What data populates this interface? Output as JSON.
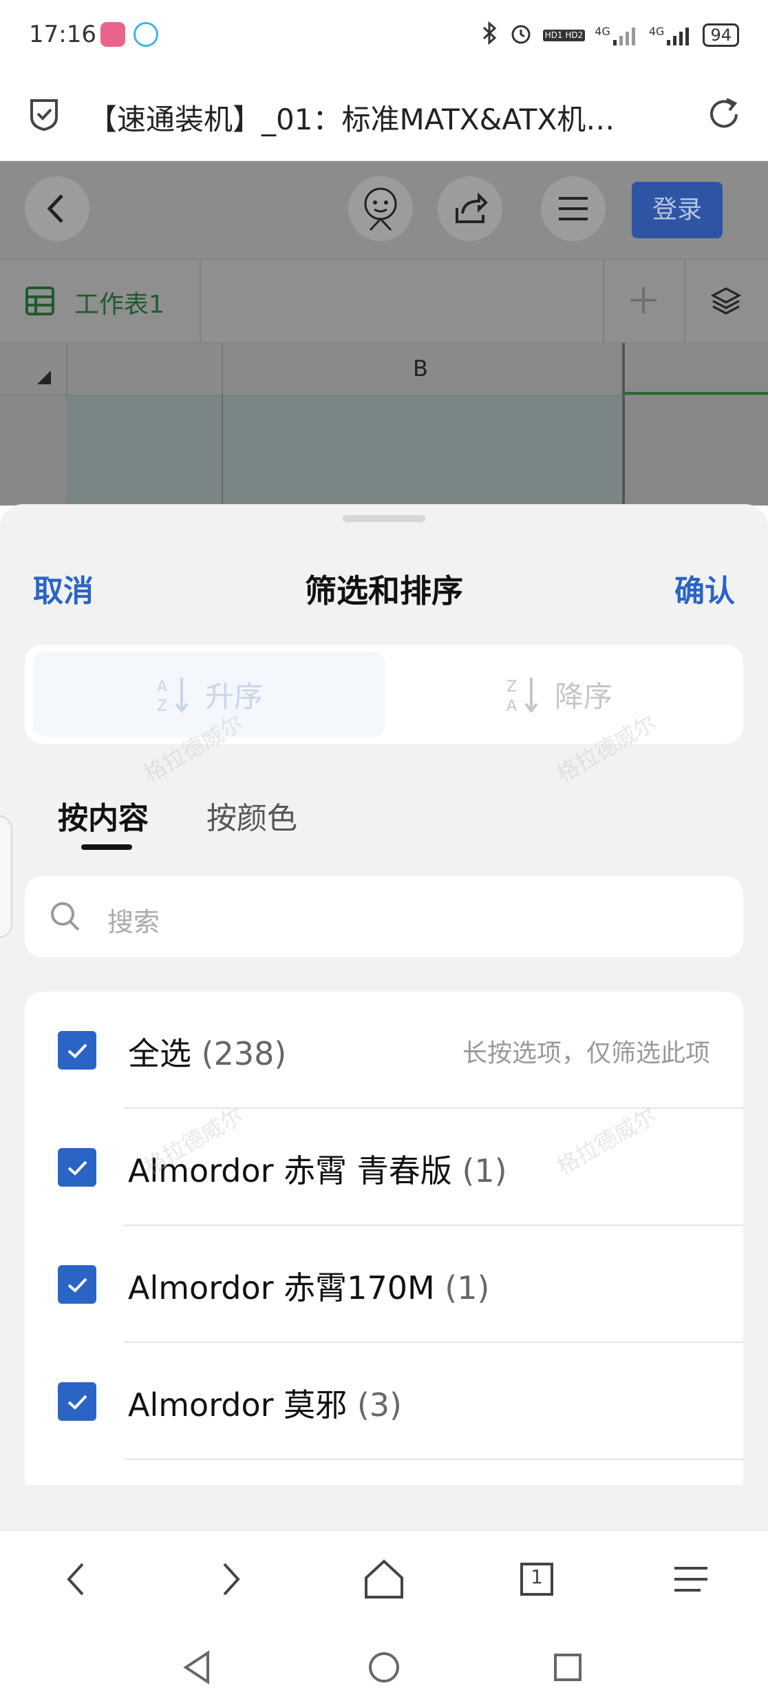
{
  "status_bar": {
    "time": "17:16",
    "battery": "94",
    "network_labels": [
      "4G",
      "4G"
    ],
    "hd_label": "HD1 HD2"
  },
  "browser": {
    "title": "【速通装机】_01：标准MATX&ATX机…",
    "tab_count": "1"
  },
  "app_header": {
    "login_label": "登录"
  },
  "sheet_tabs": {
    "active_sheet": "工作表1",
    "column_b": "B"
  },
  "filter_sheet": {
    "cancel_label": "取消",
    "title": "筛选和排序",
    "confirm_label": "确认",
    "sort_ascending": "升序",
    "sort_descending": "降序",
    "tabs": [
      {
        "label": "按内容",
        "active": true
      },
      {
        "label": "按颜色",
        "active": false
      }
    ],
    "search_placeholder": "搜索",
    "hint": "长按选项，仅筛选此项",
    "items": [
      {
        "label": "全选",
        "count": "(238)",
        "checked": true
      },
      {
        "label": "Almordor 赤霄 青春版",
        "count": "(1)",
        "checked": true
      },
      {
        "label": "Almordor 赤霄170M",
        "count": "(1)",
        "checked": true
      },
      {
        "label": "Almordor 莫邪",
        "count": "(3)",
        "checked": true
      }
    ]
  },
  "watermark": "格拉德威尔",
  "colors": {
    "accent": "#2a64c5",
    "login_bg": "#2e55a3",
    "sheet_bg": "#f2f2f2",
    "sheet_tab_green": "#215a2c"
  }
}
